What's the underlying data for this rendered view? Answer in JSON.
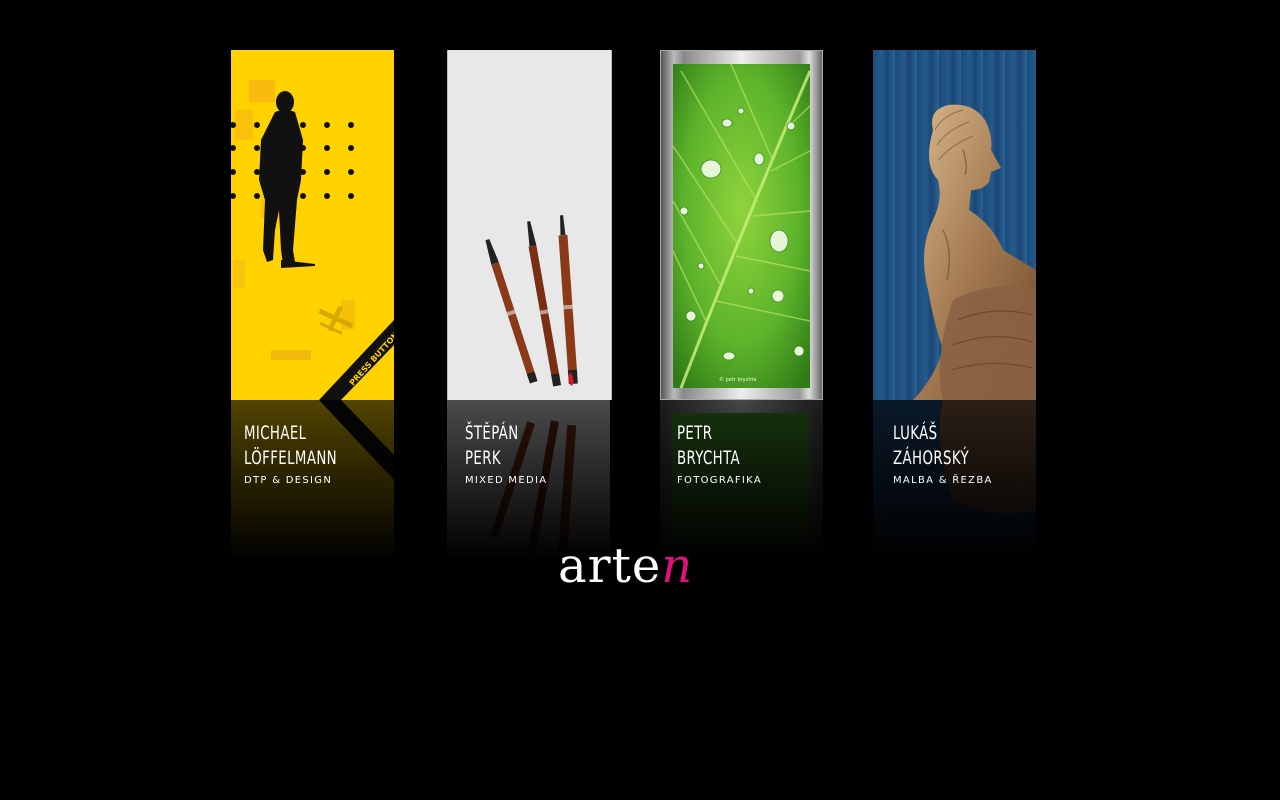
{
  "cards": [
    {
      "first": "MICHAEL",
      "last": "LÖFFELMANN",
      "field": "DTP & DESIGN",
      "tag": "PRESS BUTTON",
      "accent": "#ffd500"
    },
    {
      "first": "ŠTĚPÁN",
      "last": "PERK",
      "field": "MIXED MEDIA",
      "accent": "#e6e6e6"
    },
    {
      "first": "PETR",
      "last": "BRYCHTA",
      "field": "FOTOGRAFIKA",
      "credit": "© petr brychta",
      "accent": "#6cbf2f"
    },
    {
      "first": "LUKÁŠ",
      "last": "ZÁHORSKÝ",
      "field": "MALBA & ŘEZBA",
      "accent": "#1f5488"
    }
  ],
  "logo": {
    "main": "arte",
    "accent": "n",
    "accent_color": "#e0117f"
  }
}
